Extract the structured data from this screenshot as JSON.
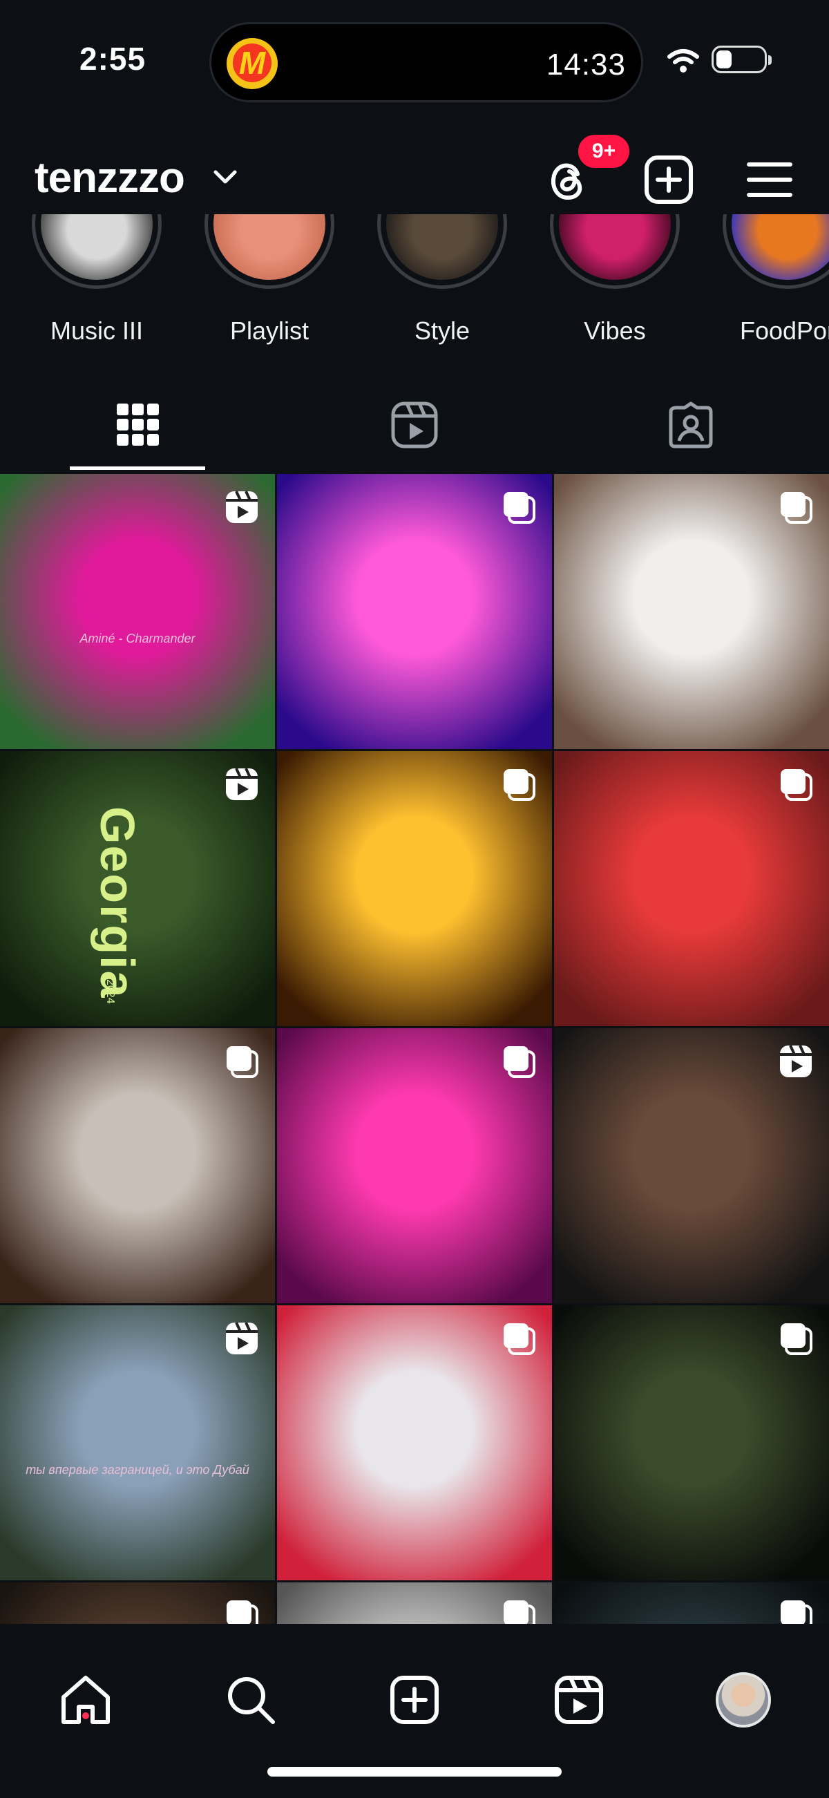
{
  "status": {
    "time": "2:55",
    "island_time": "14:33",
    "island_app_letter": "M"
  },
  "header": {
    "username": "tenzzzo",
    "threads_badge": "9+"
  },
  "highlights": [
    {
      "label": "Music III",
      "colors": [
        "#d9d9d9",
        "#333"
      ]
    },
    {
      "label": "Playlist",
      "colors": [
        "#e8907a",
        "#c86a50"
      ]
    },
    {
      "label": "Style",
      "colors": [
        "#5a4a3a",
        "#1c1a18"
      ]
    },
    {
      "label": "Vibes",
      "colors": [
        "#d0206a",
        "#3a0820"
      ]
    },
    {
      "label": "FoodPor",
      "colors": [
        "#e87820",
        "#1a2ad8"
      ]
    }
  ],
  "tabs": [
    {
      "name": "grid-tab",
      "icon": "grid-icon",
      "active": true
    },
    {
      "name": "reels-tab",
      "icon": "reels-icon",
      "active": false
    },
    {
      "name": "tagged-tab",
      "icon": "tagged-icon",
      "active": false
    }
  ],
  "posts": [
    {
      "type": "reel",
      "caption": "Aminé - Charmander",
      "word": "",
      "subtext": "",
      "colors": [
        "#e01a9a",
        "#2a6a30"
      ]
    },
    {
      "type": "carousel",
      "caption": "",
      "word": "",
      "subtext": "",
      "colors": [
        "#ff5ad8",
        "#2a0a8a"
      ]
    },
    {
      "type": "carousel",
      "caption": "",
      "word": "",
      "subtext": "",
      "colors": [
        "#f0efee",
        "#6a5040"
      ]
    },
    {
      "type": "reel",
      "caption": "",
      "word": "Georgia",
      "subtext": "2024",
      "colors": [
        "#3a5a2a",
        "#0f1e0c"
      ]
    },
    {
      "type": "carousel",
      "caption": "",
      "word": "",
      "subtext": "",
      "colors": [
        "#ffc030",
        "#3a1a02"
      ]
    },
    {
      "type": "carousel",
      "caption": "",
      "word": "",
      "subtext": "",
      "colors": [
        "#e83a3a",
        "#6a1a1a"
      ]
    },
    {
      "type": "carousel",
      "caption": "",
      "word": "",
      "subtext": "",
      "colors": [
        "#c8c0b8",
        "#3a241a"
      ]
    },
    {
      "type": "carousel",
      "caption": "",
      "word": "",
      "subtext": "",
      "colors": [
        "#ff3ab0",
        "#5a0a4a"
      ]
    },
    {
      "type": "reel",
      "caption": "",
      "word": "",
      "subtext": "",
      "colors": [
        "#6a4a3a",
        "#141414"
      ]
    },
    {
      "type": "reel",
      "caption": "ты впервые заграницей, и это Дубай",
      "word": "",
      "subtext": "",
      "colors": [
        "#8aa0b8",
        "#2a3a2a"
      ]
    },
    {
      "type": "carousel",
      "caption": "",
      "word": "",
      "subtext": "",
      "colors": [
        "#e8e6ea",
        "#d0203a"
      ]
    },
    {
      "type": "carousel",
      "caption": "",
      "word": "",
      "subtext": "",
      "colors": [
        "#3a4a2a",
        "#0a0c0a"
      ]
    },
    {
      "type": "carousel",
      "caption": "",
      "word": "",
      "subtext": "",
      "colors": [
        "#5a4030",
        "#1a1410"
      ]
    },
    {
      "type": "carousel",
      "caption": "",
      "word": "",
      "subtext": "",
      "colors": [
        "#cfcfcf",
        "#555"
      ]
    },
    {
      "type": "carousel",
      "caption": "",
      "word": "",
      "subtext": "",
      "colors": [
        "#2a3a40",
        "#0a0e10"
      ]
    }
  ],
  "bottom_nav": [
    {
      "name": "home-tab",
      "icon": "home-icon"
    },
    {
      "name": "search-tab",
      "icon": "search-icon"
    },
    {
      "name": "create-tab",
      "icon": "plus-square-icon"
    },
    {
      "name": "reels-nav-tab",
      "icon": "reels-icon"
    },
    {
      "name": "profile-tab",
      "icon": "avatar"
    }
  ]
}
